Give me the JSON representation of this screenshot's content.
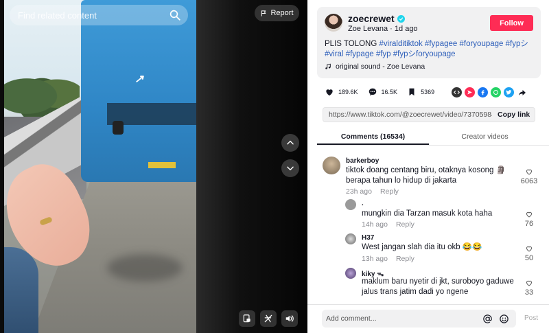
{
  "search": {
    "placeholder": "Find related content"
  },
  "video": {
    "report_label": "Report"
  },
  "author": {
    "username": "zoecrewet",
    "display_name": "Zoe Levana",
    "posted": "1d ago",
    "separator": "·",
    "follow_label": "Follow"
  },
  "caption": {
    "text": "PLIS TOLONG ",
    "tags": [
      "#viralditiktok",
      "#fypagee",
      "#foryoupage",
      "#fypシ",
      "#viral",
      "#fypage",
      "#fyp",
      "#fypシforyoupage"
    ]
  },
  "sound": {
    "label": "original sound - Zoe Levana"
  },
  "stats": {
    "likes": "189.6K",
    "comments": "16.5K",
    "saves": "5369"
  },
  "link": {
    "url": "https://www.tiktok.com/@zoecrewet/video/73705984...",
    "copy_label": "Copy link"
  },
  "tabs": [
    {
      "label": "Comments (16534)",
      "active": true
    },
    {
      "label": "Creator videos",
      "active": false
    }
  ],
  "comments": [
    {
      "user": "barkerboy",
      "text": "tiktok doang centang biru, otaknya kosong 🗿 berapa tahun lo hidup di jakarta",
      "time": "23h ago",
      "reply_label": "Reply",
      "likes": "6063"
    },
    {
      "user": ".",
      "text": "mungkin dia Tarzan masuk kota haha",
      "time": "14h ago",
      "reply_label": "Reply",
      "likes": "76"
    },
    {
      "user": "H37",
      "text": "West jangan slah dia itu okb 😂😂",
      "time": "13h ago",
      "reply_label": "Reply",
      "likes": "50"
    },
    {
      "user": "kiky ᯓ",
      "text": "maklum baru nyetir di jkt, suroboyo gaduwe jalus trans jatim dadi yo ngene",
      "time": "",
      "reply_label": "",
      "likes": "33"
    }
  ],
  "composer": {
    "placeholder": "Add comment...",
    "post_label": "Post"
  },
  "colors": {
    "accent": "#fe2c55",
    "hashtag": "#2b5db9",
    "verified": "#20d5ec"
  },
  "icons": [
    "search-icon",
    "flag-icon",
    "chevron-up-icon",
    "chevron-down-icon",
    "floating-player-icon",
    "remove-watermark-icon",
    "volume-icon",
    "verified-icon",
    "music-note-icon",
    "heart-icon",
    "comment-icon",
    "bookmark-icon",
    "embed-icon",
    "send-icon",
    "facebook-icon",
    "whatsapp-icon",
    "twitter-icon",
    "share-icon",
    "mention-icon",
    "emoji-icon"
  ]
}
